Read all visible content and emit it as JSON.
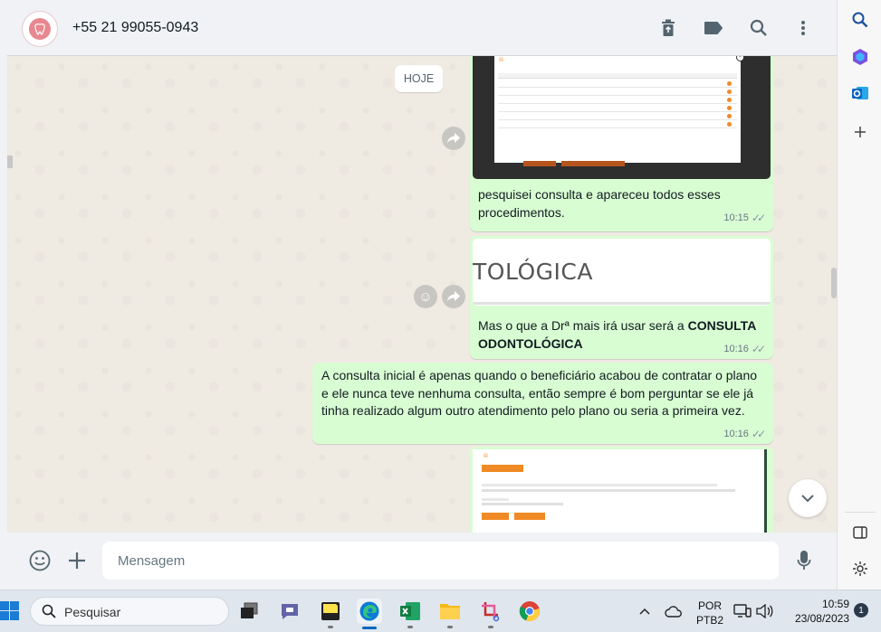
{
  "chat": {
    "contact_name": "+55 21 99055-0943",
    "date_label": "HOJE",
    "messages": [
      {
        "type": "image_caption",
        "text": "pesquisei consulta e apareceu todos esses procedimentos.",
        "time": "10:15"
      },
      {
        "type": "image_caption",
        "image_text": "TOLÓGICA",
        "text_prefix": "Mas o que a Drª mais irá usar será a ",
        "text_bold": "CONSULTA ODONTOLÓGICA",
        "time": "10:16"
      },
      {
        "type": "text",
        "text": "A consulta inicial é apenas quando o beneficiário acabou de contratar o plano e ele nunca teve nenhuma consulta, então sempre é bom perguntar se ele já tinha realizado algum outro atendimento pelo plano ou seria a primeira vez.",
        "time": "10:16"
      }
    ],
    "input_placeholder": "Mensagem"
  },
  "icons": {
    "header": [
      "trash-icon",
      "label-icon",
      "search-icon",
      "menu-icon"
    ],
    "footer": [
      "emoji-icon",
      "plus-icon",
      "mic-icon"
    ],
    "side": [
      "search-icon",
      "copilot-icon",
      "outlook-icon",
      "add-icon",
      "sidebar-icon",
      "settings-icon"
    ]
  },
  "taskbar": {
    "search_label": "Pesquisar",
    "lang_top": "POR",
    "lang_bottom": "PTB2",
    "time": "10:59",
    "date": "23/08/2023",
    "notification_count": "1"
  },
  "colors": {
    "outgoing_bubble": "#d9fdd3",
    "chat_bg": "#efeae2",
    "header_bg": "#f0f2f5",
    "accent_orange": "#f08a24"
  }
}
